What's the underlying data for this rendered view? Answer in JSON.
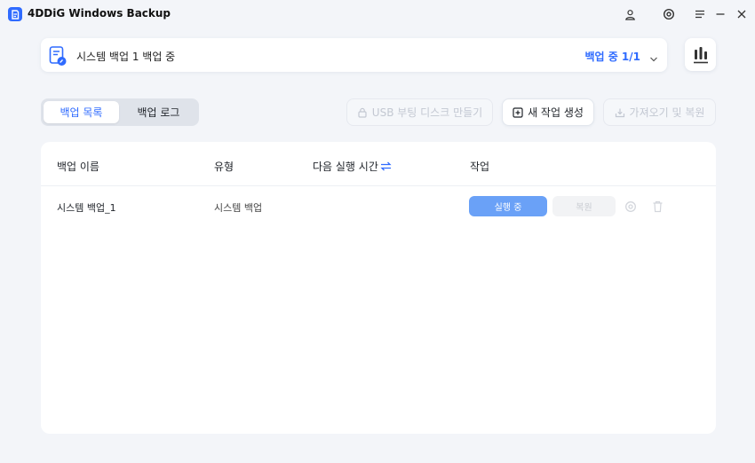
{
  "app": {
    "title": "4DDiG Windows Backup"
  },
  "window_controls": {
    "account": "user-icon",
    "settings": "gear-icon",
    "menu": "menu-icon",
    "minimize": "minimize-icon",
    "close": "close-icon"
  },
  "status": {
    "text": "시스템 백업 1 백업 중",
    "progress": "백업 중 1/1"
  },
  "tabs": [
    {
      "label": "백업 목록",
      "active": true
    },
    {
      "label": "백업 로그",
      "active": false
    }
  ],
  "toolbar": {
    "usb_label": "USB 부팅 디스크 만들기",
    "new_task_label": "새 작업 생성",
    "import_label": "가져오기 및 복원"
  },
  "table": {
    "columns": [
      "백업 이름",
      "유형",
      "다음 실행 시간",
      "작업"
    ],
    "rows": [
      {
        "name": "시스템 백업_1",
        "type": "시스템 백업",
        "next_run": "",
        "run_label": "실행 중",
        "restore_label": "복원"
      }
    ]
  },
  "colors": {
    "accent": "#2f6bff",
    "run_button": "#6aa1f7",
    "background": "#f3f5f9"
  }
}
